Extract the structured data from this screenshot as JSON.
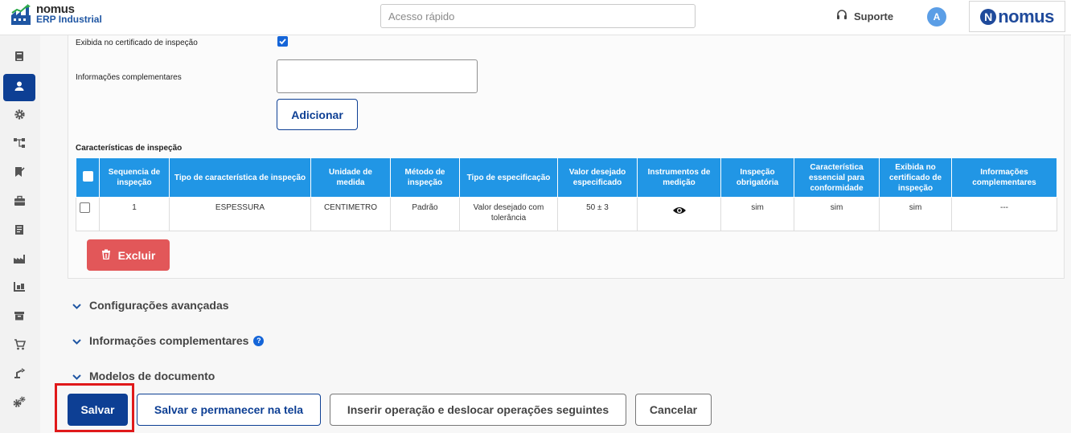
{
  "header": {
    "brand_name": "nomus",
    "brand_sub": "ERP Industrial",
    "quick_access_placeholder": "Acesso rápido",
    "support_label": "Suporte",
    "avatar_initial": "A",
    "logo_letter": "N",
    "logo_word": "nomus"
  },
  "sidebar": {
    "items": [
      {
        "icon": "book-icon"
      },
      {
        "icon": "user-icon",
        "active": true
      },
      {
        "icon": "gear-icon"
      },
      {
        "icon": "hierarchy-icon"
      },
      {
        "icon": "bookmark-icon"
      },
      {
        "icon": "briefcase-icon"
      },
      {
        "icon": "receipt-icon"
      },
      {
        "icon": "factory-icon"
      },
      {
        "icon": "warehouse-icon"
      },
      {
        "icon": "archive-icon"
      },
      {
        "icon": "cart-icon"
      },
      {
        "icon": "robot-arm-icon"
      },
      {
        "icon": "gears-icon"
      }
    ]
  },
  "form": {
    "exibida_label": "Exibida no certificado de inspeção",
    "info_label": "Informações complementares",
    "info_value": "",
    "add_button": "Adicionar",
    "section_title": "Características de inspeção"
  },
  "table": {
    "headers": [
      "Sequencia de inspeção",
      "Tipo de característica de inspeção",
      "Unidade de medida",
      "Método de inspeção",
      "Tipo de especificação",
      "Valor desejado especificado",
      "Instrumentos de medição",
      "Inspeção obrigatória",
      "Característica essencial para conformidade",
      "Exibida no certificado de inspeção",
      "Informações complementares"
    ],
    "rows": [
      {
        "sequencia": "1",
        "tipo": "ESPESSURA",
        "unidade": "CENTIMETRO",
        "metodo": "Padrão",
        "especificacao": "Valor desejado com tolerância",
        "valor": "50 ± 3",
        "obrigatoria": "sim",
        "essencial": "sim",
        "exibida": "sim",
        "info": "---"
      }
    ]
  },
  "delete_button": "Excluir",
  "accordions": {
    "advanced": "Configurações avançadas",
    "complementary": "Informações complementares",
    "documents": "Modelos de documento"
  },
  "footer": {
    "save": "Salvar",
    "save_stay": "Salvar e permanecer na tela",
    "insert": "Inserir operação e deslocar operações seguintes",
    "cancel": "Cancelar"
  },
  "colors": {
    "primary": "#0d3f94",
    "table_header": "#2196e5",
    "danger": "#e25759",
    "highlight": "#e0191a"
  }
}
